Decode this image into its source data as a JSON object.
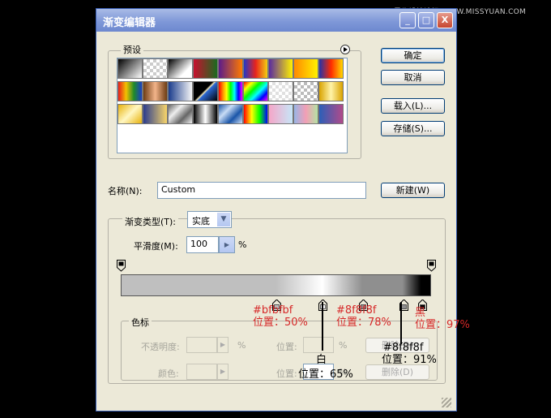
{
  "watermark": "思缘设计论坛 WWW.MISSYUAN.COM",
  "window": {
    "title": "渐变编辑器",
    "buttons": {
      "minimize": "_",
      "maximize": "□",
      "close": "X"
    }
  },
  "presets": {
    "label": "预设",
    "swatches": [
      "linear-gradient(135deg,#000,#fff)",
      "repeating-conic-gradient(#ccc 0 25%,#fff 0 50%) 0 0/8px 8px",
      "linear-gradient(135deg,#000,#fff 70%)",
      "linear-gradient(90deg,#c8102e,#1a6b1f)",
      "linear-gradient(90deg,#5b1b8a,#ff7a00)",
      "linear-gradient(90deg,#2338c7,#e8241c,#f3d011)",
      "linear-gradient(90deg,#5a2aa0,#fff200)",
      "linear-gradient(90deg,#ff8a00,#fff200)",
      "linear-gradient(90deg,#2233aa,#ff2a00,#ffd800)",
      "linear-gradient(90deg,#e81b1b,#f2c200,#1f8a2a,#1b3fc5)",
      "linear-gradient(90deg,#6d3b12,#f2b48a,#6d3b12)",
      "linear-gradient(90deg,#1a3c8c,#f7f7f7)",
      "linear-gradient(135deg,#000 0 45%,#f2e7b8 50%,#2a66d1 55%,#000 100%)",
      "linear-gradient(90deg,#ff0000,#ff8800,#ffff00,#00ff00,#00ffff,#0000ff,#ff00ff)",
      "linear-gradient(135deg,#ff0000,#ffff00,#00ff00,#00ffff,#0000ff,#ff00ff)",
      "repeating-conic-gradient(#e0e0e0 0 25%,#fff 0 50%) 0 0/8px 8px",
      "repeating-conic-gradient(#bbb 0 25%,#fff 0 50%) 0 0/8px 8px",
      "linear-gradient(90deg,#d9a300,#fff3a8,#d9a300)",
      "linear-gradient(135deg,#e7b10a,#fff7c2,#e7b10a)",
      "linear-gradient(90deg,#2a3c8e,#f8d56a)",
      "linear-gradient(135deg,#666,#eee,#666,#eee)",
      "linear-gradient(90deg,#000,#fff,#000)",
      "linear-gradient(135deg,#1a55a8,#c8dcf5,#1a55a8,#c8dcf5)",
      "linear-gradient(90deg,#ff0000,#ffff00,#00ff00,#0000ff)",
      "linear-gradient(90deg,#f5a6c8,#c6e6f8)",
      "linear-gradient(90deg,#99b6e6,#f29eb5,#b5e3a4)",
      "linear-gradient(90deg,#2b5fb8,#b14a8a)"
    ],
    "menu_icon": "right-arrow-circle-icon"
  },
  "side_buttons": {
    "ok": "确定",
    "cancel": "取消",
    "load": "载入(L)...",
    "save": "存储(S)...",
    "new": "新建(W)"
  },
  "name": {
    "label": "名称(N):",
    "value": "Custom"
  },
  "gradient_type": {
    "label": "渐变类型(T):",
    "value": "实底"
  },
  "smoothness": {
    "label": "平滑度(M):",
    "value": "100",
    "unit": "%"
  },
  "gradient": {
    "colors": [
      "#bfbfbf",
      "#bfbfbf",
      "#ffffff",
      "#8f8f8f",
      "#8f8f8f",
      "#000000"
    ],
    "color_stop_positions": [
      0,
      50,
      65,
      78,
      91,
      97
    ],
    "opacity_stop_positions": [
      0,
      100
    ]
  },
  "color_stops": {
    "label": "色标",
    "opacity_label": "不透明度:",
    "opacity_value": "",
    "percent": "%",
    "location_label": "位置:",
    "delete_label": "删除(D)",
    "color_label": "颜色:"
  },
  "annotations": [
    {
      "text": "#bfbfbf",
      "kind": "red"
    },
    {
      "text": "位置：50%",
      "kind": "red"
    },
    {
      "text": "#8f8f8f",
      "kind": "red"
    },
    {
      "text": "位置：78%",
      "kind": "red"
    },
    {
      "text": "黑",
      "kind": "red"
    },
    {
      "text": "位置：97%",
      "kind": "red"
    },
    {
      "text": "#8f8f8f",
      "kind": "black"
    },
    {
      "text": "位置：91%",
      "kind": "black"
    },
    {
      "text": "白",
      "kind": "black"
    },
    {
      "text": "位置：65%",
      "kind": "black"
    }
  ]
}
